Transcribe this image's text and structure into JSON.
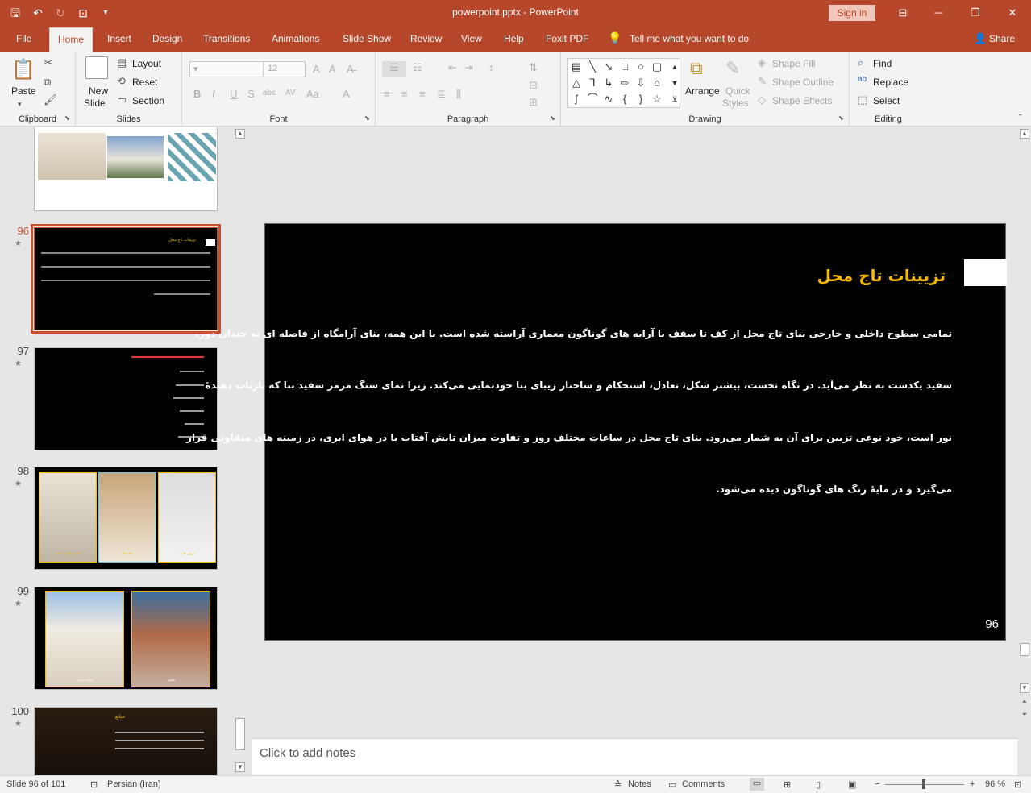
{
  "window": {
    "title": "powerpoint.pptx - PowerPoint",
    "signin": "Sign in"
  },
  "tabs": [
    "File",
    "Home",
    "Insert",
    "Design",
    "Transitions",
    "Animations",
    "Slide Show",
    "Review",
    "View",
    "Help",
    "Foxit PDF"
  ],
  "tell_me": "Tell me what you want to do",
  "share": "Share",
  "ribbon": {
    "clipboard": {
      "paste": "Paste",
      "label": "Clipboard"
    },
    "slides": {
      "new_slide_1": "New",
      "new_slide_2": "Slide",
      "layout": "Layout",
      "reset": "Reset",
      "section": "Section",
      "label": "Slides"
    },
    "font": {
      "size": "12",
      "bold": "B",
      "italic": "I",
      "underline": "U",
      "shadow": "S",
      "strike": "abc",
      "spacing": "AV",
      "case": "Aa",
      "color": "A",
      "label": "Font"
    },
    "paragraph": {
      "label": "Paragraph"
    },
    "drawing": {
      "arrange": "Arrange",
      "quick_styles_1": "Quick",
      "quick_styles_2": "Styles",
      "shape_fill": "Shape Fill",
      "shape_outline": "Shape Outline",
      "shape_effects": "Shape Effects",
      "label": "Drawing"
    },
    "editing": {
      "find": "Find",
      "replace": "Replace",
      "select": "Select",
      "label": "Editing"
    }
  },
  "thumbnails": [
    {
      "number": "",
      "kind": "images"
    },
    {
      "number": "96",
      "star": "★",
      "selected": true,
      "title": "تزیینات تاج محل"
    },
    {
      "number": "97",
      "star": "★"
    },
    {
      "number": "98",
      "star": "★",
      "captions": [
        "نقش حکاری سنگ",
        "تلویه ها",
        "پروین هاری"
      ]
    },
    {
      "number": "99",
      "star": "★",
      "captions": [
        "سنگ تراشی",
        "نقاشی"
      ]
    },
    {
      "number": "100",
      "star": "★",
      "title": "منابع"
    }
  ],
  "slide": {
    "title": "تزیینات تاج محل",
    "lines": [
      "تمامی سطوح داخلی و خارجی بنای تاج محل از کف تا سقف با آرایه های گوناگون معماری آراسته شده است. با این همه، بنای آرامگاه از فاصله ای نه چندان دور،",
      "سفید یکدست به نظر می‌آید. در نگاه نخست، بیشتر شکل، تعادل، استحکام و ساختار زیبای بنا خودنمایی می‌کند. زیرا نمای سنگ مرمر سفید بنا که بازتاب دهندهٔ",
      "نور است، خود نوعی تزیین برای آن به شمار می‌رود. بنای تاج محل در ساعات مختلف روز و تفاوت میزان تابش آفتاب یا در هوای ابری، در زمینه های متفاوتی قرار",
      "می‌گیرد و در مایهٔ رنگ های گوناگون دیده می‌شود."
    ],
    "page_number": "96",
    "title_color": "#f5b800"
  },
  "notes_placeholder": "Click to add notes",
  "status": {
    "slide_info": "Slide 96 of 101",
    "language": "Persian (Iran)",
    "notes": "Notes",
    "comments": "Comments",
    "zoom": "96 %",
    "zoom_level": 0.96
  },
  "colors": {
    "accent": "#b7472a",
    "selected_thumb": "#c8502f",
    "gold": "#f5b800"
  }
}
